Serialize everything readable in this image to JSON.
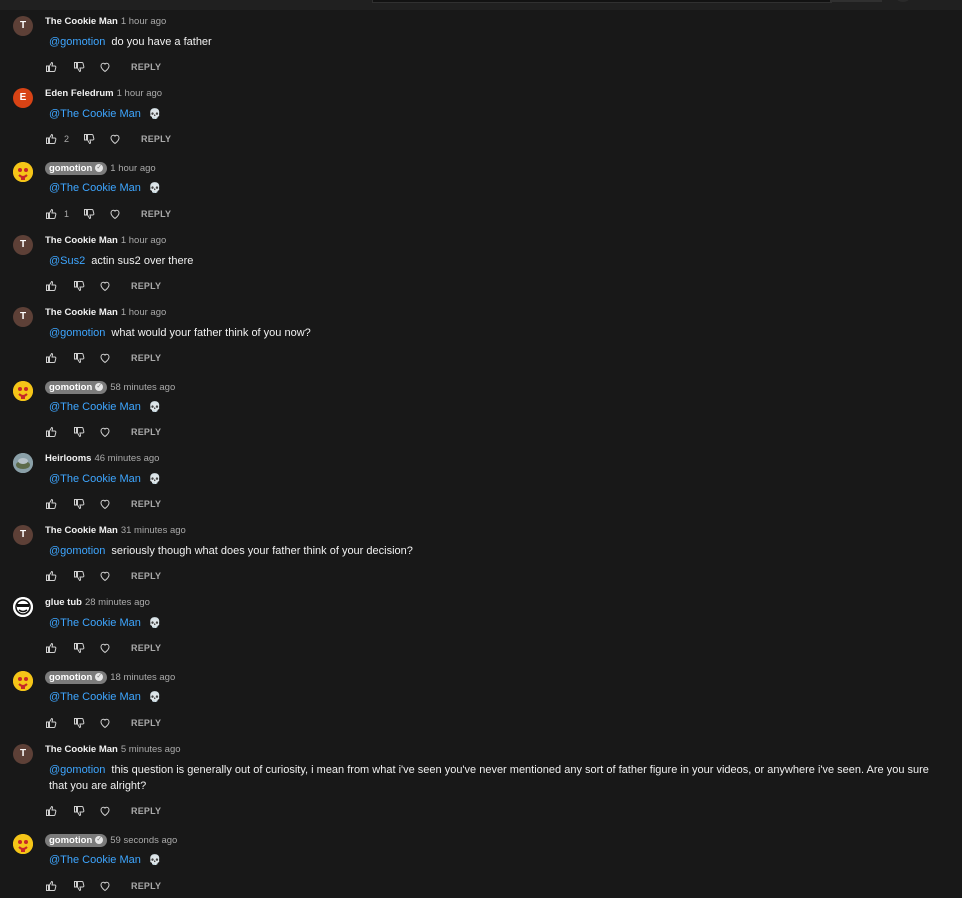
{
  "icons": {
    "like": "thumb-up-icon",
    "dislike": "thumb-down-icon",
    "heart": "heart-icon",
    "verified": "check-icon",
    "skull": "skull-emoji"
  },
  "colors": {
    "background": "#181818",
    "mention": "#3ea6ff",
    "meta_text": "#aaaaaa",
    "text": "#f1f1f1",
    "author_chip": "#7b7b7b"
  },
  "reply_label": "REPLY",
  "comments": [
    {
      "author": "The Cookie Man",
      "avatar_letter": "T",
      "time": "1 hour ago",
      "mention": "@gomotion",
      "text": "do you have a father",
      "likes": ""
    },
    {
      "author": "Eden Feledrum",
      "avatar_letter": "E",
      "time": "1 hour ago",
      "mention": "@The Cookie Man",
      "text": "💀",
      "likes": "2"
    },
    {
      "author": "gomotion",
      "avatar_letter": "",
      "time": "1 hour ago",
      "mention": "@The Cookie Man",
      "text": "💀",
      "likes": "1"
    },
    {
      "author": "The Cookie Man",
      "avatar_letter": "T",
      "time": "1 hour ago",
      "mention": "@Sus2",
      "text": "actin sus2 over there",
      "likes": ""
    },
    {
      "author": "The Cookie Man",
      "avatar_letter": "T",
      "time": "1 hour ago",
      "mention": "@gomotion",
      "text": "what would your father think of you now?",
      "likes": ""
    },
    {
      "author": "gomotion",
      "avatar_letter": "",
      "time": "58 minutes ago",
      "mention": "@The Cookie Man",
      "text": "💀",
      "likes": ""
    },
    {
      "author": "Heirlooms",
      "avatar_letter": "",
      "time": "46 minutes ago",
      "mention": "@The Cookie Man",
      "text": "💀",
      "likes": ""
    },
    {
      "author": "The Cookie Man",
      "avatar_letter": "T",
      "time": "31 minutes ago",
      "mention": "@gomotion",
      "text": "seriously though what does your father think of your decision?",
      "likes": ""
    },
    {
      "author": "glue tub",
      "avatar_letter": "",
      "time": "28 minutes ago",
      "mention": "@The Cookie Man",
      "text": "💀",
      "likes": ""
    },
    {
      "author": "gomotion",
      "avatar_letter": "",
      "time": "18 minutes ago",
      "mention": "@The Cookie Man",
      "text": "💀",
      "likes": ""
    },
    {
      "author": "The Cookie Man",
      "avatar_letter": "T",
      "time": "5 minutes ago",
      "mention": "@gomotion",
      "text": "this question is generally out of curiosity, i mean from what i've seen you've never mentioned any sort of father figure in your videos, or anywhere i've seen. Are you sure that you are alright?",
      "likes": ""
    },
    {
      "author": "gomotion",
      "avatar_letter": "",
      "time": "59 seconds ago",
      "mention": "@The Cookie Man",
      "text": "💀",
      "likes": ""
    }
  ]
}
